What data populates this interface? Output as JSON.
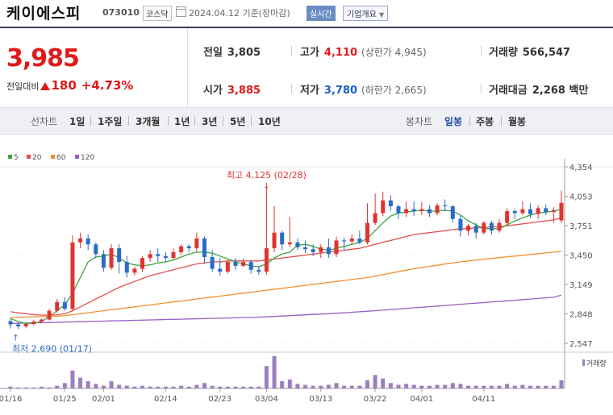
{
  "header": {
    "name": "케이에스피",
    "code": "073010",
    "market": "코스닥",
    "date_text": "2024.04.12  기준(장마감)",
    "realtime_label": "실시간",
    "corp_label": "기업개요"
  },
  "quote": {
    "price": "3,985",
    "change_label": "전일대비",
    "change_amount": "180",
    "change_pct": "+4.73%",
    "prev_close_label": "전일",
    "prev_close": "3,805",
    "open_label": "시가",
    "open": "3,885",
    "high_label": "고가",
    "high": "4,110",
    "upper_limit": "(상한가 4,945)",
    "low_label": "저가",
    "low": "3,780",
    "lower_limit": "(하한가 2,665)",
    "volume_label": "거래량",
    "volume": "566,547",
    "amount_label": "거래대금",
    "amount": "2,268",
    "amount_unit": "백만"
  },
  "tabs": {
    "line_chart": "선차트",
    "periods": [
      "1일",
      "1주일",
      "3개월",
      "1년",
      "3년",
      "5년",
      "10년"
    ],
    "candle_chart": "봉차트",
    "candle_periods": [
      "일봉",
      "주봉",
      "월봉"
    ],
    "selected_candle": "일봉"
  },
  "chart_data": {
    "type": "candlestick",
    "legend": [
      "5",
      "20",
      "60",
      "120"
    ],
    "colors": {
      "ma5": "#3da53d",
      "ma20": "#e05050",
      "ma60": "#f09030",
      "ma120": "#9b5ec6",
      "up": "#e03333",
      "down": "#2a6cc8",
      "volume": "#9b7fbf"
    },
    "y_ticks": [
      "4,354",
      "4,053",
      "3,751",
      "3,450",
      "3,149",
      "2,848",
      "2,547"
    ],
    "ylim": [
      2547,
      4354
    ],
    "x_ticks": [
      "01/16",
      "01/25",
      "02/01",
      "02/14",
      "02/23",
      "03/04",
      "03/13",
      "03/22",
      "04/01",
      "04/11"
    ],
    "volume_label": "거래량",
    "annotation_high": "최고 4,125 (02/28)",
    "annotation_low": "최저 2,690 (01/17)",
    "candles": [
      [
        2774,
        2800,
        2700,
        2740
      ],
      [
        2740,
        2760,
        2690,
        2720
      ],
      [
        2720,
        2760,
        2700,
        2745
      ],
      [
        2745,
        2790,
        2730,
        2770
      ],
      [
        2770,
        2800,
        2750,
        2790
      ],
      [
        2790,
        2900,
        2780,
        2880
      ],
      [
        2880,
        3000,
        2860,
        2970
      ],
      [
        2970,
        3020,
        2880,
        2900
      ],
      [
        2900,
        3650,
        2880,
        3580
      ],
      [
        3580,
        3680,
        3520,
        3620
      ],
      [
        3620,
        3660,
        3500,
        3560
      ],
      [
        3560,
        3580,
        3420,
        3460
      ],
      [
        3460,
        3500,
        3280,
        3320
      ],
      [
        3320,
        3560,
        3300,
        3520
      ],
      [
        3520,
        3560,
        3260,
        3380
      ],
      [
        3380,
        3440,
        3220,
        3270
      ],
      [
        3270,
        3330,
        3240,
        3310
      ],
      [
        3310,
        3440,
        3280,
        3420
      ],
      [
        3420,
        3500,
        3380,
        3460
      ],
      [
        3460,
        3520,
        3380,
        3440
      ],
      [
        3440,
        3480,
        3380,
        3420
      ],
      [
        3420,
        3520,
        3410,
        3480
      ],
      [
        3480,
        3560,
        3450,
        3540
      ],
      [
        3540,
        3560,
        3480,
        3520
      ],
      [
        3520,
        3680,
        3480,
        3620
      ],
      [
        3620,
        3640,
        3360,
        3430
      ],
      [
        3430,
        3500,
        3280,
        3310
      ],
      [
        3310,
        3420,
        3240,
        3280
      ],
      [
        3280,
        3400,
        3260,
        3380
      ],
      [
        3380,
        3420,
        3300,
        3340
      ],
      [
        3340,
        3420,
        3330,
        3380
      ],
      [
        3380,
        3400,
        3260,
        3300
      ],
      [
        3300,
        3340,
        3250,
        3280
      ],
      [
        3280,
        4130,
        3250,
        3520
      ],
      [
        3520,
        3950,
        3480,
        3680
      ],
      [
        3680,
        3700,
        3500,
        3560
      ],
      [
        3560,
        3840,
        3530,
        3580
      ],
      [
        3580,
        3620,
        3500,
        3530
      ],
      [
        3530,
        3600,
        3470,
        3510
      ],
      [
        3510,
        3560,
        3440,
        3480
      ],
      [
        3480,
        3560,
        3420,
        3530
      ],
      [
        3530,
        3620,
        3420,
        3460
      ],
      [
        3460,
        3640,
        3430,
        3600
      ],
      [
        3600,
        3630,
        3500,
        3590
      ],
      [
        3590,
        3660,
        3560,
        3620
      ],
      [
        3620,
        3700,
        3560,
        3580
      ],
      [
        3580,
        3980,
        3560,
        3780
      ],
      [
        3780,
        4080,
        3760,
        3880
      ],
      [
        3880,
        4100,
        3850,
        4010
      ],
      [
        4010,
        4060,
        3900,
        3950
      ],
      [
        3950,
        3970,
        3820,
        3880
      ],
      [
        3880,
        4000,
        3840,
        3920
      ],
      [
        3920,
        4000,
        3850,
        3900
      ],
      [
        3900,
        3990,
        3860,
        3920
      ],
      [
        3920,
        3960,
        3840,
        3880
      ],
      [
        3880,
        3980,
        3860,
        3960
      ],
      [
        3960,
        4020,
        3900,
        3950
      ],
      [
        3950,
        3960,
        3780,
        3820
      ],
      [
        3820,
        3860,
        3640,
        3700
      ],
      [
        3700,
        3770,
        3650,
        3750
      ],
      [
        3750,
        3780,
        3620,
        3680
      ],
      [
        3680,
        3800,
        3660,
        3780
      ],
      [
        3780,
        3800,
        3660,
        3700
      ],
      [
        3700,
        3820,
        3680,
        3780
      ],
      [
        3780,
        3930,
        3760,
        3900
      ],
      [
        3900,
        3920,
        3820,
        3880
      ],
      [
        3880,
        4000,
        3860,
        3920
      ],
      [
        3920,
        3980,
        3830,
        3870
      ],
      [
        3870,
        3960,
        3820,
        3930
      ],
      [
        3930,
        3970,
        3860,
        3890
      ],
      [
        3890,
        3940,
        3780,
        3910
      ],
      [
        3805,
        4110,
        3780,
        3985
      ]
    ],
    "ma5": [
      2800,
      2770,
      2750,
      2752,
      2770,
      2820,
      2880,
      2940,
      3060,
      3220,
      3380,
      3430,
      3440,
      3460,
      3420,
      3370,
      3350,
      3340,
      3350,
      3370,
      3380,
      3400,
      3430,
      3460,
      3480,
      3480,
      3470,
      3440,
      3410,
      3380,
      3360,
      3340,
      3330,
      3360,
      3420,
      3460,
      3480,
      3550,
      3560,
      3540,
      3510,
      3500,
      3520,
      3540,
      3560,
      3580,
      3620,
      3700,
      3780,
      3850,
      3880,
      3890,
      3900,
      3910,
      3900,
      3900,
      3910,
      3900,
      3860,
      3800,
      3760,
      3720,
      3720,
      3720,
      3760,
      3800,
      3830,
      3860,
      3880,
      3890,
      3900,
      3920
    ],
    "ma20": [
      2870,
      2860,
      2850,
      2840,
      2835,
      2835,
      2840,
      2850,
      2880,
      2920,
      2960,
      3000,
      3040,
      3080,
      3120,
      3150,
      3180,
      3210,
      3240,
      3260,
      3280,
      3300,
      3320,
      3340,
      3360,
      3370,
      3380,
      3380,
      3390,
      3390,
      3390,
      3390,
      3390,
      3400,
      3410,
      3420,
      3430,
      3440,
      3450,
      3460,
      3470,
      3480,
      3490,
      3500,
      3510,
      3520,
      3540,
      3560,
      3580,
      3600,
      3620,
      3640,
      3660,
      3670,
      3680,
      3690,
      3700,
      3710,
      3720,
      3720,
      3730,
      3730,
      3740,
      3740,
      3750,
      3760,
      3770,
      3780,
      3790,
      3800,
      3810,
      3830
    ],
    "ma60": [
      2810,
      2812,
      2815,
      2818,
      2820,
      2822,
      2825,
      2830,
      2840,
      2850,
      2860,
      2870,
      2880,
      2890,
      2900,
      2910,
      2920,
      2930,
      2940,
      2950,
      2960,
      2970,
      2980,
      2990,
      3000,
      3010,
      3020,
      3030,
      3040,
      3050,
      3060,
      3070,
      3080,
      3090,
      3100,
      3110,
      3120,
      3130,
      3140,
      3150,
      3160,
      3170,
      3180,
      3190,
      3200,
      3210,
      3220,
      3235,
      3250,
      3265,
      3280,
      3295,
      3310,
      3322,
      3334,
      3346,
      3358,
      3370,
      3380,
      3390,
      3400,
      3408,
      3416,
      3424,
      3432,
      3440,
      3448,
      3456,
      3464,
      3472,
      3480,
      3488
    ],
    "ma120": [
      2750,
      2752,
      2754,
      2756,
      2758,
      2760,
      2762,
      2764,
      2766,
      2768,
      2770,
      2772,
      2774,
      2776,
      2778,
      2780,
      2782,
      2784,
      2786,
      2788,
      2790,
      2792,
      2794,
      2796,
      2798,
      2800,
      2802,
      2804,
      2806,
      2808,
      2810,
      2812,
      2814,
      2818,
      2822,
      2826,
      2830,
      2834,
      2838,
      2842,
      2846,
      2850,
      2855,
      2860,
      2865,
      2870,
      2875,
      2880,
      2886,
      2892,
      2898,
      2904,
      2910,
      2916,
      2922,
      2928,
      2934,
      2940,
      2946,
      2952,
      2958,
      2964,
      2970,
      2976,
      2982,
      2988,
      2994,
      3000,
      3006,
      3012,
      3018,
      3040
    ],
    "volume": [
      2,
      1,
      1,
      1,
      2,
      1,
      3,
      6,
      20,
      12,
      8,
      5,
      3,
      8,
      4,
      3,
      2,
      3,
      2,
      2,
      2,
      2,
      3,
      2,
      4,
      6,
      3,
      2,
      2,
      2,
      2,
      2,
      2,
      25,
      36,
      8,
      10,
      5,
      4,
      3,
      3,
      4,
      6,
      3,
      3,
      3,
      9,
      15,
      11,
      6,
      4,
      5,
      4,
      3,
      3,
      4,
      4,
      6,
      5,
      3,
      3,
      3,
      3,
      3,
      5,
      3,
      4,
      3,
      3,
      3,
      3,
      9
    ]
  }
}
